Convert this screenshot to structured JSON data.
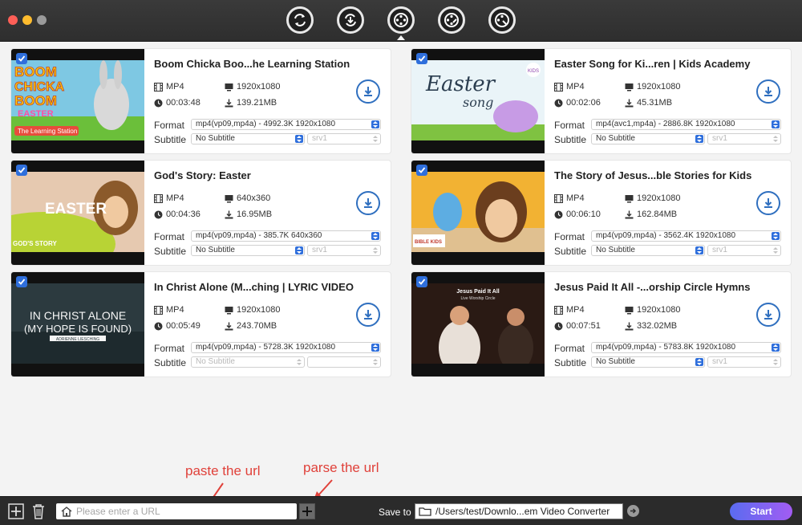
{
  "toolbar": {
    "buttons": [
      {
        "icon": "convert-icon"
      },
      {
        "icon": "download-refresh-icon"
      },
      {
        "icon": "video-download-icon",
        "active": true
      },
      {
        "icon": "video-edit-icon"
      },
      {
        "icon": "video-tools-icon"
      }
    ]
  },
  "labels": {
    "format": "Format",
    "subtitle": "Subtitle"
  },
  "videos": [
    {
      "title": "Boom Chicka Boo...he Learning Station",
      "container": "MP4",
      "resolution": "1920x1080",
      "duration": "00:03:48",
      "size": "139.21MB",
      "format": "mp4(vp09,mp4a) - 4992.3K 1920x1080",
      "subtitle": "No Subtitle",
      "subtitle_format": "srv1",
      "subtitle_disabled": false
    },
    {
      "title": "Easter Song for Ki...ren | Kids Academy",
      "container": "MP4",
      "resolution": "1920x1080",
      "duration": "00:02:06",
      "size": "45.31MB",
      "format": "mp4(avc1,mp4a) - 2886.8K 1920x1080",
      "subtitle": "No Subtitle",
      "subtitle_format": "srv1",
      "subtitle_disabled": false
    },
    {
      "title": "God's Story: Easter",
      "container": "MP4",
      "resolution": "640x360",
      "duration": "00:04:36",
      "size": "16.95MB",
      "format": "mp4(vp09,mp4a) - 385.7K 640x360",
      "subtitle": "No Subtitle",
      "subtitle_format": "srv1",
      "subtitle_disabled": false
    },
    {
      "title": "The Story of Jesus...ble Stories for Kids",
      "container": "MP4",
      "resolution": "1920x1080",
      "duration": "00:06:10",
      "size": "162.84MB",
      "format": "mp4(vp09,mp4a) - 3562.4K 1920x1080",
      "subtitle": "No Subtitle",
      "subtitle_format": "srv1",
      "subtitle_disabled": false
    },
    {
      "title": "In Christ Alone (M...ching | LYRIC VIDEO",
      "container": "MP4",
      "resolution": "1920x1080",
      "duration": "00:05:49",
      "size": "243.70MB",
      "format": "mp4(vp09,mp4a) - 5728.3K 1920x1080",
      "subtitle": "No Subtitle",
      "subtitle_format": "",
      "subtitle_disabled": true
    },
    {
      "title": "Jesus Paid It All -...orship Circle Hymns",
      "container": "MP4",
      "resolution": "1920x1080",
      "duration": "00:07:51",
      "size": "332.02MB",
      "format": "mp4(vp09,mp4a) - 5783.8K 1920x1080",
      "subtitle": "No Subtitle",
      "subtitle_format": "srv1",
      "subtitle_disabled": false
    }
  ],
  "thumbnails": {
    "t1": {
      "lines": [
        "BOOM",
        "CHICKA",
        "BOOM",
        "EASTER"
      ],
      "tag": "The Learning Station"
    },
    "t2": {
      "lines": [
        "Easter",
        "song"
      ],
      "tag": "KIDS"
    },
    "t3": {
      "lines": [
        "EASTER"
      ],
      "tag": "GOD'S STORY"
    },
    "t4": {
      "tag": "BIBLE KIDS"
    },
    "t5": {
      "lines": [
        "IN CHRIST ALONE",
        "(MY HOPE IS FOUND)"
      ],
      "tag": "ADRIENNE LIESCHING"
    },
    "t6": {
      "lines": [
        "Jesus Paid It All"
      ],
      "tag": "Live Worship Circle"
    }
  },
  "annotations": {
    "paste": "paste the url",
    "parse": "parse the url"
  },
  "bottom": {
    "url_placeholder": "Please enter a URL",
    "save_to_label": "Save to",
    "save_path": "/Users/test/Downlo...em Video Converter",
    "start_label": "Start"
  }
}
